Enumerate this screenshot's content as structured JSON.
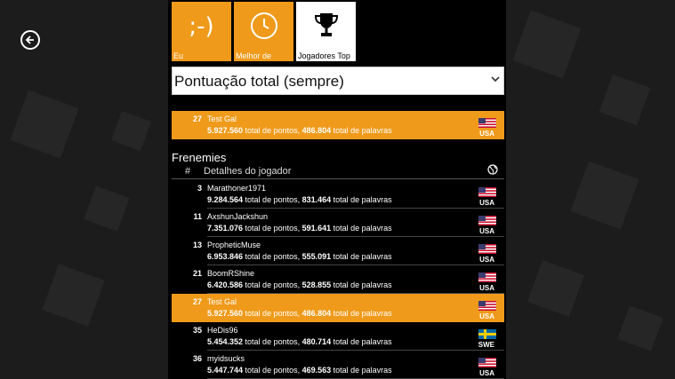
{
  "nav": {
    "back_icon": "back-arrow-icon"
  },
  "tiles": [
    {
      "label": "Eu",
      "icon": ";-)",
      "state": "normal"
    },
    {
      "label": "Melhor de",
      "icon": "clock-icon",
      "state": "normal"
    },
    {
      "label": "Jogadores Top",
      "icon": "trophy-icon",
      "state": "selected"
    }
  ],
  "filter": {
    "selected": "Pontuação total (sempre)"
  },
  "my_entry": {
    "rank": "27",
    "name": "Test Gal",
    "points": "5.927.560",
    "points_suffix": " total de pontos, ",
    "words": "486.804",
    "words_suffix": " total de palavras",
    "country": "USA"
  },
  "frenemies": {
    "title": "Frenemies",
    "col_rank": "#",
    "col_details": "Detalhes do jogador",
    "col_country_icon": "globe-icon",
    "rows": [
      {
        "rank": "3",
        "name": "Marathoner1971",
        "points": "9.284.564",
        "words": "831.464",
        "country": "USA",
        "me": false
      },
      {
        "rank": "11",
        "name": "AxshunJackshun",
        "points": "7.351.076",
        "words": "591.641",
        "country": "USA",
        "me": false
      },
      {
        "rank": "13",
        "name": "PropheticMuse",
        "points": "6.953.846",
        "words": "555.091",
        "country": "USA",
        "me": false
      },
      {
        "rank": "21",
        "name": "BoomRShine",
        "points": "6.420.586",
        "words": "528.855",
        "country": "USA",
        "me": false
      },
      {
        "rank": "27",
        "name": "Test Gal",
        "points": "5.927.560",
        "words": "486.804",
        "country": "USA",
        "me": true
      },
      {
        "rank": "35",
        "name": "HeDis96",
        "points": "5.454.352",
        "words": "480.714",
        "country": "SWE",
        "me": false
      },
      {
        "rank": "36",
        "name": "myidsucks",
        "points": "5.447.744",
        "words": "469.563",
        "country": "USA",
        "me": false
      }
    ],
    "points_suffix": " total de pontos, ",
    "words_suffix": " total de palavras"
  },
  "colors": {
    "accent": "#ef9a1a",
    "panel": "#000000",
    "background": "#1c1c1c"
  }
}
